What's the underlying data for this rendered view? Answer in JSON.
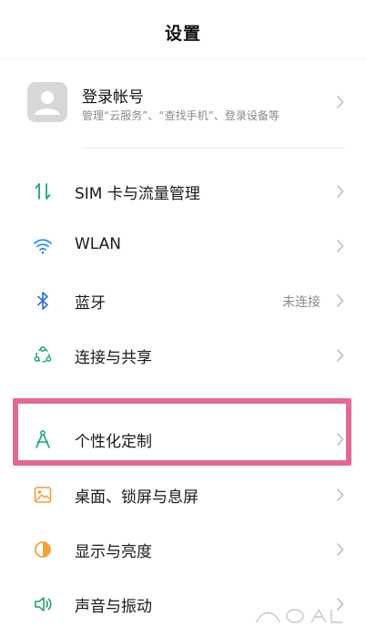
{
  "header": {
    "title": "设置"
  },
  "account": {
    "title": "登录帐号",
    "subtitle": "管理“云服务”、“查找手机”、登录设备等"
  },
  "rows": [
    {
      "label": "SIM 卡与流量管理",
      "icon": "sim-data-icon",
      "color": "#1aa57a"
    },
    {
      "label": "WLAN",
      "icon": "wifi-icon",
      "color": "#2b8fe3"
    },
    {
      "label": "蓝牙",
      "icon": "bluetooth-icon",
      "value": "未连接",
      "color": "#2b6fe3"
    },
    {
      "label": "连接与共享",
      "icon": "connection-share-icon",
      "color": "#1aa57a"
    },
    {
      "label": "个性化定制",
      "icon": "personalization-compass-icon",
      "color": "#1aa57a"
    },
    {
      "label": "桌面、锁屏与息屏",
      "icon": "wallpaper-icon",
      "color": "#f29a3a"
    },
    {
      "label": "显示与亮度",
      "icon": "display-brightness-icon",
      "color": "#f2a23a"
    },
    {
      "label": "声音与振动",
      "icon": "sound-icon",
      "color": "#23a06a"
    }
  ],
  "highlight_color": "#e06a97"
}
